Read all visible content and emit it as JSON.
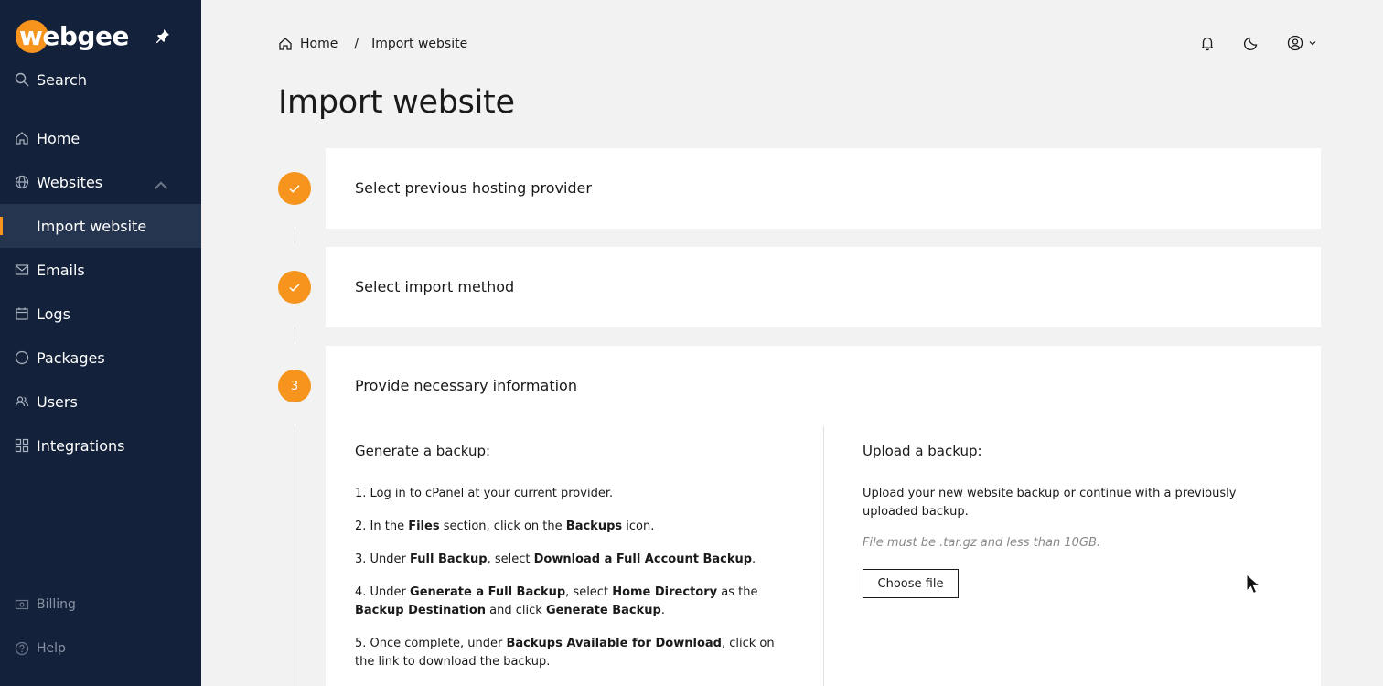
{
  "sidebar": {
    "logo": "webgee",
    "search": "Search",
    "items": [
      {
        "label": "Home"
      },
      {
        "label": "Websites"
      },
      {
        "label": "Import website"
      },
      {
        "label": "Emails"
      },
      {
        "label": "Logs"
      },
      {
        "label": "Packages"
      },
      {
        "label": "Users"
      },
      {
        "label": "Integrations"
      }
    ],
    "footer": [
      {
        "label": "Billing"
      },
      {
        "label": "Help"
      }
    ]
  },
  "header": {
    "breadcrumb_home": "Home",
    "breadcrumb_sep": "/",
    "breadcrumb_current": "Import website"
  },
  "page": {
    "title": "Import website"
  },
  "steps": [
    {
      "title": "Select previous hosting provider",
      "status": "done"
    },
    {
      "title": "Select import method",
      "status": "done"
    },
    {
      "number": "3",
      "title": "Provide necessary information",
      "status": "active"
    }
  ],
  "generate": {
    "title": "Generate a backup:"
  },
  "upload": {
    "title": "Upload a backup:",
    "text": "Upload your new website backup or continue with a previously uploaded backup.",
    "hint": "File must be .tar.gz and less than 10GB.",
    "button": "Choose file"
  },
  "instructions": [
    [
      {
        "t": "1. Log in to cPanel at your current provider."
      }
    ],
    [
      {
        "t": "2. In the "
      },
      {
        "t": "Files",
        "b": true
      },
      {
        "t": " section, click on the "
      },
      {
        "t": "Backups",
        "b": true
      },
      {
        "t": " icon."
      }
    ],
    [
      {
        "t": "3. Under "
      },
      {
        "t": "Full Backup",
        "b": true
      },
      {
        "t": ", select "
      },
      {
        "t": "Download a Full Account Backup",
        "b": true
      },
      {
        "t": "."
      }
    ],
    [
      {
        "t": "4. Under "
      },
      {
        "t": "Generate a Full Backup",
        "b": true
      },
      {
        "t": ", select "
      },
      {
        "t": "Home Directory",
        "b": true
      },
      {
        "t": " as the "
      },
      {
        "t": "Backup Destination",
        "b": true
      },
      {
        "t": " and click "
      },
      {
        "t": "Generate Backup",
        "b": true
      },
      {
        "t": "."
      }
    ],
    [
      {
        "t": "5. Once complete, under "
      },
      {
        "t": "Backups Available for Download",
        "b": true
      },
      {
        "t": ", click on the link to download the backup."
      }
    ]
  ],
  "colors": {
    "accent": "#f7941d",
    "sidebar": "#13213a",
    "sidebar_active": "#253550",
    "background": "#f2f2f2"
  },
  "icons": [
    "pin-icon",
    "search-icon",
    "home-icon",
    "globe-icon",
    "mail-icon",
    "calendar-icon",
    "package-icon",
    "users-icon",
    "grid-icon",
    "billing-icon",
    "help-icon",
    "bell-icon",
    "moon-icon",
    "user-circle-icon",
    "check-icon",
    "cursor-icon"
  ]
}
